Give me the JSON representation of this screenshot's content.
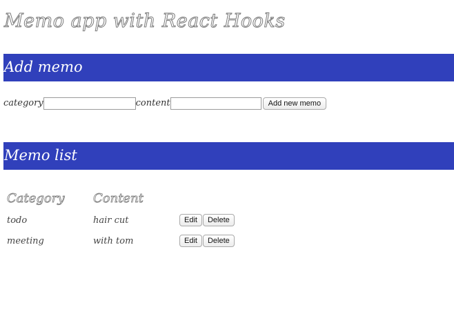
{
  "app": {
    "title": "Memo app with React Hooks"
  },
  "add_section": {
    "heading": "Add memo",
    "category_label": "category",
    "category_value": "",
    "category_placeholder": "",
    "content_label": "content",
    "content_value": "",
    "content_placeholder": "",
    "add_button_label": "Add new memo"
  },
  "list_section": {
    "heading": "Memo list",
    "columns": {
      "category": "Category",
      "content": "Content"
    },
    "memos": [
      {
        "category": "todo",
        "content": "hair cut",
        "edit_label": "Edit",
        "delete_label": "Delete"
      },
      {
        "category": "meeting",
        "content": "with tom",
        "edit_label": "Edit",
        "delete_label": "Delete"
      }
    ]
  },
  "colors": {
    "header_background": "#3040bb",
    "header_text": "#ffffff"
  }
}
